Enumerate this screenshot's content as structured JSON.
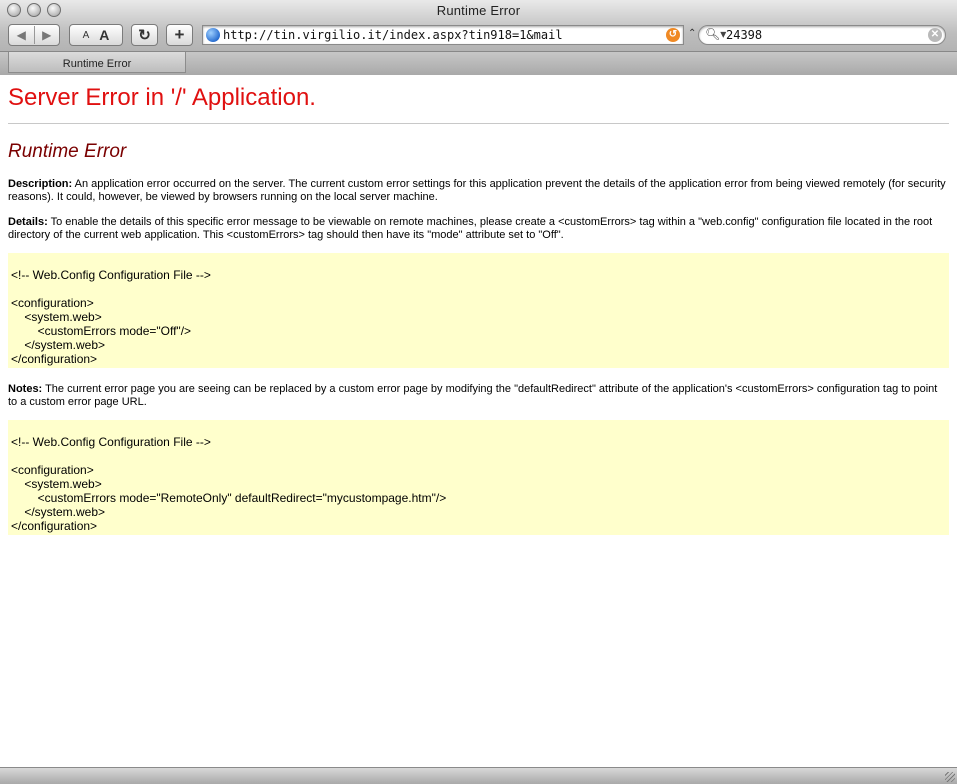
{
  "window": {
    "title": "Runtime Error"
  },
  "toolbar": {
    "back_glyph": "◀",
    "forward_glyph": "▶",
    "text_small": "A",
    "text_large": "A",
    "reload_glyph": "↻",
    "add_glyph": "+",
    "address_url": "http://tin.virgilio.it/index.aspx?tin918=1&mail",
    "search_value": "24398",
    "icons": {
      "site": "globe-icon",
      "snapback": "snapback-icon",
      "search": "magnifier-icon",
      "clear": "clear-search-icon"
    }
  },
  "tabs": [
    {
      "label": "Runtime Error"
    }
  ],
  "page": {
    "heading": "Server Error in '/' Application.",
    "subheading": "Runtime Error",
    "description_label": "Description:",
    "description_text": " An application error occurred on the server. The current custom error settings for this application prevent the details of the application error from being viewed remotely (for security reasons). It could, however, be viewed by browsers running on the local server machine.",
    "details_label": "Details:",
    "details_text": " To enable the details of this specific error message to be viewable on remote machines, please create a <customErrors> tag within a \"web.config\" configuration file located in the root directory of the current web application. This <customErrors> tag should then have its \"mode\" attribute set to \"Off\".",
    "code1": "<!-- Web.Config Configuration File -->\n\n<configuration>\n    <system.web>\n        <customErrors mode=\"Off\"/>\n    </system.web>\n</configuration>",
    "notes_label": "Notes:",
    "notes_text": " The current error page you are seeing can be replaced by a custom error page by modifying the \"defaultRedirect\" attribute of the application's <customErrors> configuration tag to point to a custom error page URL.",
    "code2": "<!-- Web.Config Configuration File -->\n\n<configuration>\n    <system.web>\n        <customErrors mode=\"RemoteOnly\" defaultRedirect=\"mycustompage.htm\"/>\n    </system.web>\n</configuration>"
  },
  "colors": {
    "heading": "#e01010",
    "subheading": "#7a0000",
    "code_bg": "#ffffcc"
  }
}
